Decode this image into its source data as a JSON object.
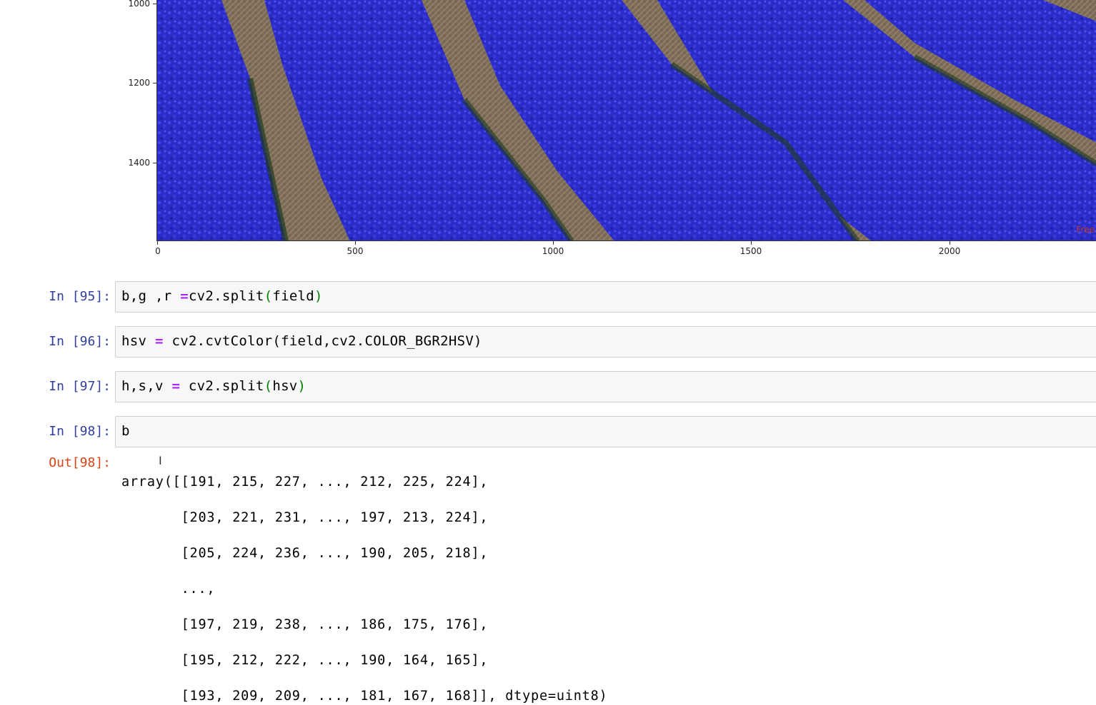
{
  "plot": {
    "y_ticks": [
      "1000",
      "1200",
      "1400"
    ],
    "x_ticks": [
      "0",
      "500",
      "1000",
      "1500",
      "2000"
    ],
    "watermark": "Free",
    "image_description_colors": {
      "flowers": "#2a2ad0",
      "soil": "#7a6a55",
      "foliage": "#1e3a1e"
    }
  },
  "cells": [
    {
      "prompt": "In [95]:",
      "code": "b,g ,r =cv2.split(field)"
    },
    {
      "prompt": "In [96]:",
      "code": "hsv = cv2.cvtColor(field,cv2.COLOR_BGR2HSV)"
    },
    {
      "prompt": "In [97]:",
      "code": "h,s,v = cv2.split(hsv)"
    },
    {
      "prompt": "In [98]:",
      "code": "b"
    }
  ],
  "output": {
    "prompt": "Out[98]:",
    "lines": [
      "array([[191, 215, 227, ..., 212, 225, 224],",
      "       [203, 221, 231, ..., 197, 213, 224],",
      "       [205, 224, 236, ..., 190, 205, 218],",
      "       ...,",
      "       [197, 219, 238, ..., 186, 175, 176],",
      "       [195, 212, 222, ..., 190, 164, 165],",
      "       [193, 209, 209, ..., 181, 167, 168]], dtype=uint8)"
    ]
  }
}
